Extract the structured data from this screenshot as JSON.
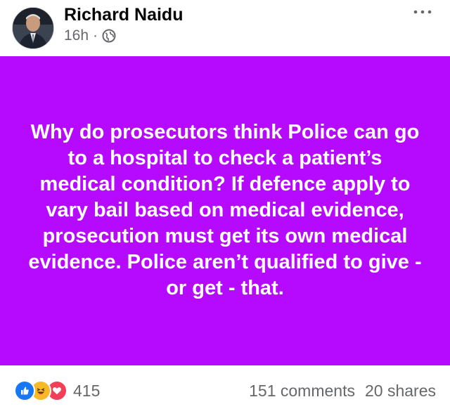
{
  "post": {
    "author": "Richard Naidu",
    "time": "16h",
    "separator": "·",
    "privacy_icon": "globe-icon",
    "text": "Why do prosecutors think Police can go to a hospital to check a patient’s medical condition? If defence apply to vary bail based on medical evidence, prosecution must get its own medical evidence. Police aren’t qualified to give - or get - that.",
    "background_color": "#b60aff",
    "text_color": "#ffffff"
  },
  "reactions": {
    "icons": [
      "like-icon",
      "haha-icon",
      "love-icon"
    ],
    "count": "415"
  },
  "stats": {
    "comments": "151 comments",
    "shares": "20 shares"
  }
}
